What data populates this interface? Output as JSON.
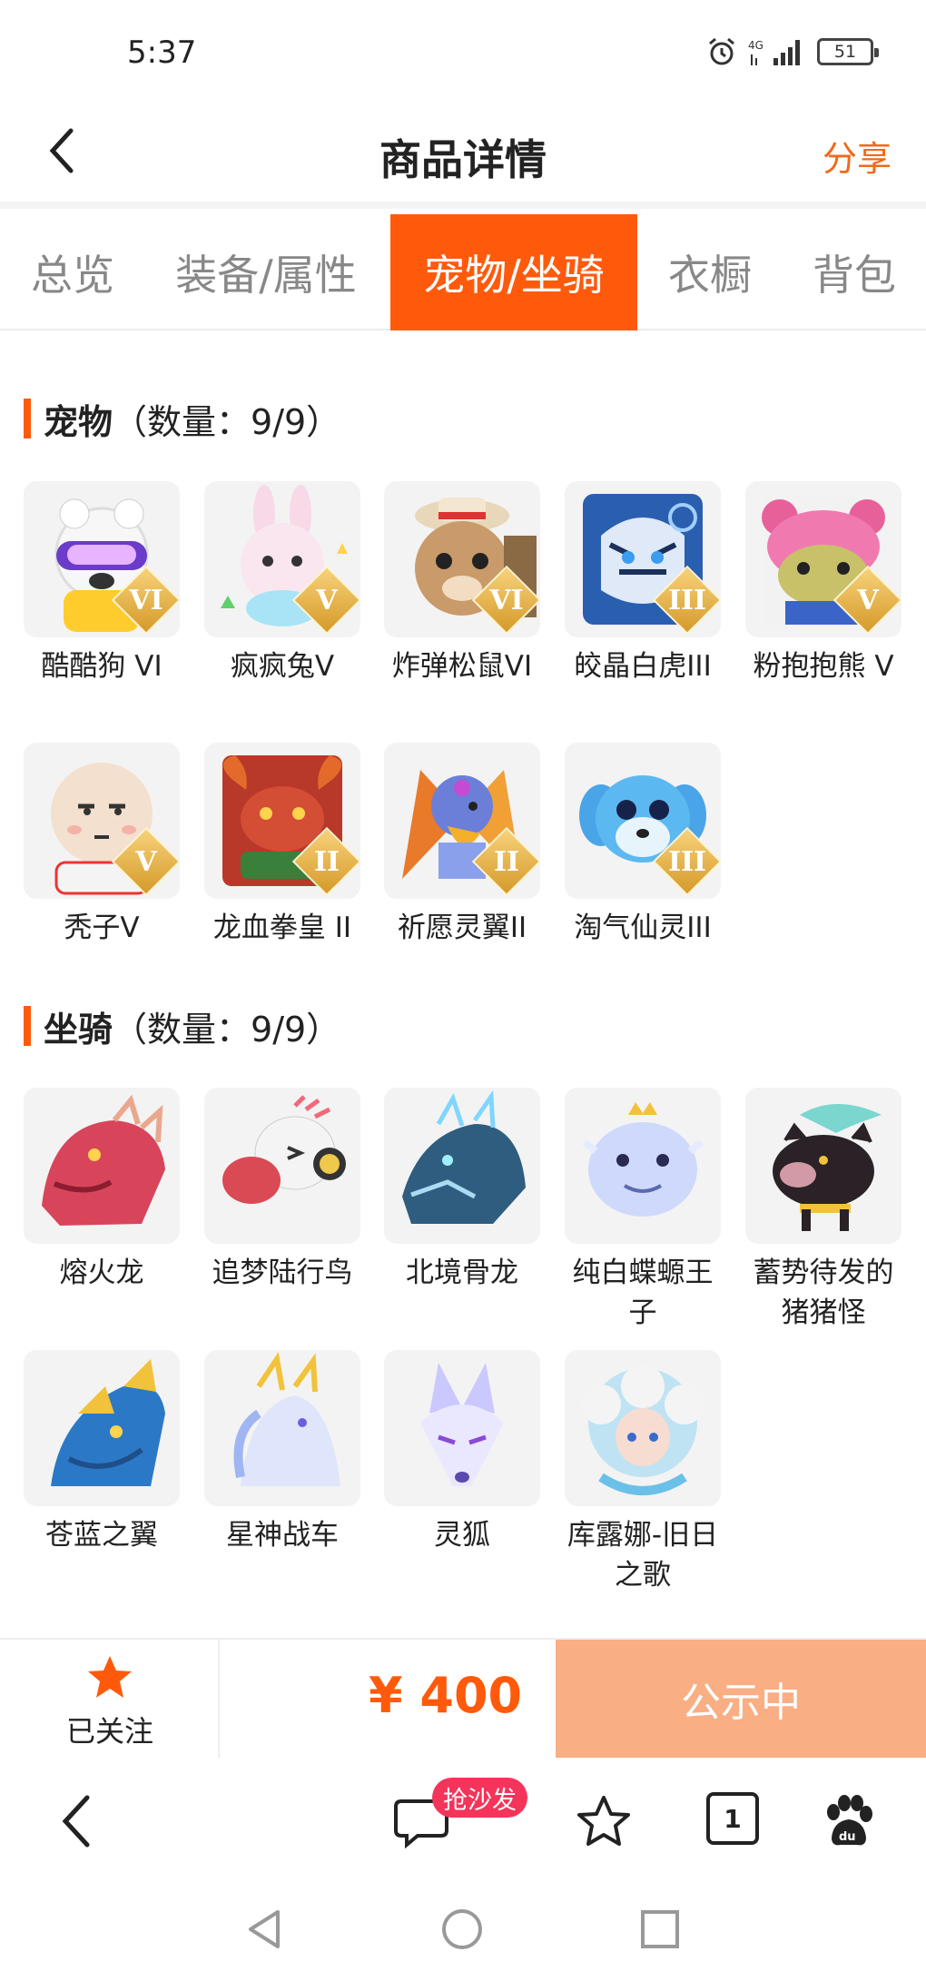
{
  "status_bar": {
    "time": "5:37",
    "battery": "51"
  },
  "header": {
    "title": "商品详情",
    "share": "分享"
  },
  "tabs": [
    {
      "label": "总览"
    },
    {
      "label": "装备/属性"
    },
    {
      "label": "宠物/坐骑"
    },
    {
      "label": "衣橱"
    },
    {
      "label": "背包"
    }
  ],
  "pets": {
    "title": "宠物",
    "count": "（数量：9/9）",
    "items": [
      {
        "name": "酷酷狗 VI",
        "rank": "VI"
      },
      {
        "name": "疯疯兔V",
        "rank": "V"
      },
      {
        "name": "炸弹松鼠VI",
        "rank": "VI"
      },
      {
        "name": "皎晶白虎III",
        "rank": "III"
      },
      {
        "name": "粉抱抱熊 V",
        "rank": "V"
      },
      {
        "name": "秃子V",
        "rank": "V"
      },
      {
        "name": "龙血拳皇 II",
        "rank": "II"
      },
      {
        "name": "祈愿灵翼II",
        "rank": "II"
      },
      {
        "name": "淘气仙灵III",
        "rank": "III"
      }
    ]
  },
  "mounts": {
    "title": "坐骑",
    "count": "（数量：9/9）",
    "items": [
      {
        "name": "熔火龙"
      },
      {
        "name": "追梦陆行鸟"
      },
      {
        "name": "北境骨龙"
      },
      {
        "name": "纯白蝶螈王子"
      },
      {
        "name": "蓄势待发的猪猪怪"
      },
      {
        "name": "苍蓝之翼"
      },
      {
        "name": "星神战车"
      },
      {
        "name": "灵狐"
      },
      {
        "name": "库露娜-旧日之歌"
      }
    ]
  },
  "action_bar": {
    "follow_label": "已关注",
    "price": "¥ 400",
    "status": "公示中"
  },
  "browser_bar": {
    "sofa_badge": "抢沙发",
    "tab_count": "1"
  },
  "colors": {
    "accent": "#ff5a0c",
    "share": "#f06a1a",
    "status_button": "#f9ae83",
    "badge": "#f4345b"
  }
}
